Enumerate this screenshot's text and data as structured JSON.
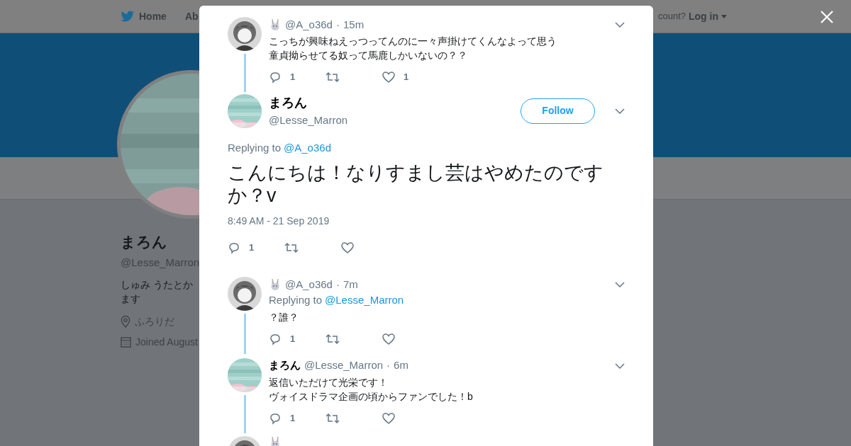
{
  "nav": {
    "home": "Home",
    "about": "Ab",
    "account_prompt": "count?",
    "login": "Log in"
  },
  "profile": {
    "name": "まろん",
    "handle": "@Lesse_Marron",
    "bio": [
      "しゅみ うたとか",
      "ます"
    ],
    "location": "ふろりだ",
    "joined": "Joined August"
  },
  "thread": [
    {
      "kind": "reply",
      "name_emoji": true,
      "handle": "@A_o36d",
      "separator": "·",
      "time": "15m",
      "lines": [
        "こっちが興味ねえっつってんのに一々声掛けてくんなよって思う",
        "童貞拗らせてる奴って馬鹿しかいないの？？"
      ],
      "reply_count": "1",
      "like_count": "1"
    },
    {
      "kind": "focus",
      "name": "まろん",
      "handle": "@Lesse_Marron",
      "follow": "Follow",
      "replying_label": "Replying to",
      "replying_to": "@A_o36d",
      "lines": [
        "こんにちは！なりすまし芸はやめたのですか？v"
      ],
      "date": "8:49 AM - 21 Sep 2019",
      "reply_count": "1"
    },
    {
      "kind": "reply",
      "name_emoji": true,
      "handle": "@A_o36d",
      "separator": "·",
      "time": "7m",
      "replying_label": "Replying to",
      "replying_to": "@Lesse_Marron",
      "lines": [
        "？誰？"
      ],
      "reply_count": "1"
    },
    {
      "kind": "reply",
      "name": "まろん",
      "handle": "@Lesse_Marron",
      "separator": "·",
      "time": "6m",
      "lines": [
        "返信いただけて光栄です！",
        "ヴォイスドラマ企画の頃からファンでした！b"
      ],
      "reply_count": "1"
    },
    {
      "kind": "stub",
      "name_emoji": true
    }
  ]
}
